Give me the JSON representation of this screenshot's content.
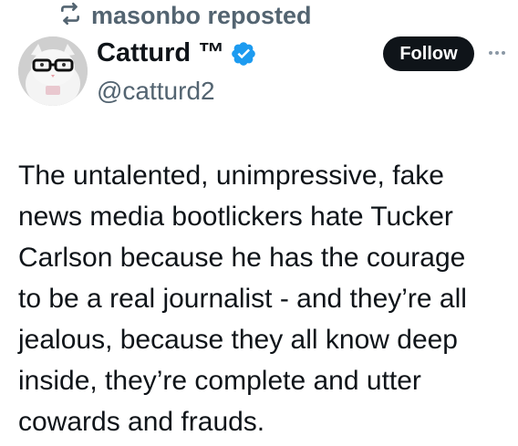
{
  "repost": {
    "label": "masonbo reposted",
    "icon": "repost-icon"
  },
  "author": {
    "display_name": "Catturd ™",
    "handle": "@catturd2",
    "verified": true,
    "verified_color": "#1d9bf0",
    "avatar_icon": "cat-with-glasses-avatar"
  },
  "actions": {
    "follow_label": "Follow",
    "more_icon": "more-options-icon"
  },
  "tweet": {
    "text": "The untalented, unimpressive, fake\nnews media bootlickers hate Tucker\nCarlson because he has the courage\nto be a real journalist - and they’re all\njealous, because they all know deep\ninside, they’re complete and utter\ncowards and frauds."
  },
  "colors": {
    "text_primary": "#0f1419",
    "text_secondary": "#536471",
    "button_bg": "#0f1419",
    "button_text": "#ffffff"
  }
}
